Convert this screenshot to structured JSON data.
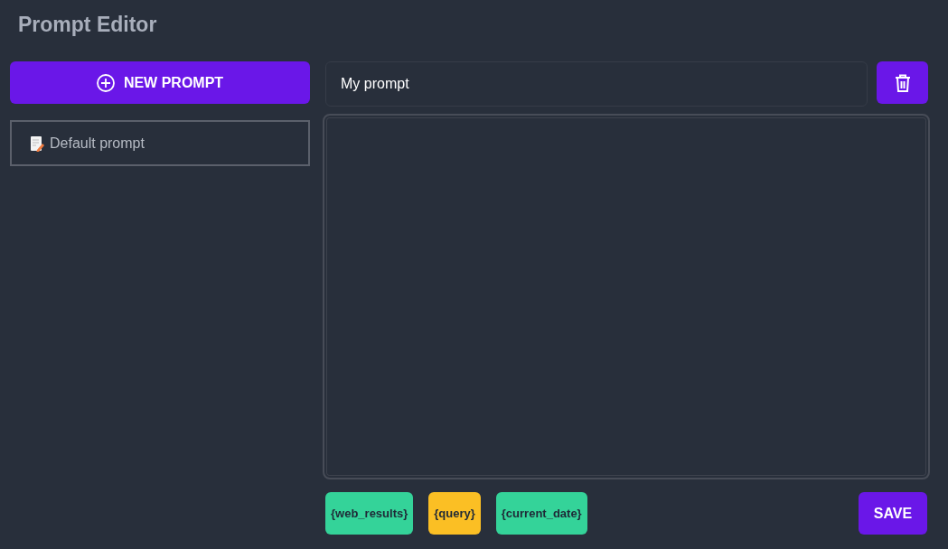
{
  "header": {
    "title": "Prompt Editor"
  },
  "sidebar": {
    "new_button": "NEW PROMPT",
    "items": [
      {
        "label": "Default prompt",
        "selected": true
      }
    ]
  },
  "editor": {
    "name_field": {
      "value": "My prompt"
    },
    "variables": [
      {
        "label": "{web_results}",
        "color": "#34d399"
      },
      {
        "label": "{query}",
        "color": "#fbbf24"
      },
      {
        "label": "{current_date}",
        "color": "#34d399"
      }
    ],
    "save_button": "SAVE"
  }
}
